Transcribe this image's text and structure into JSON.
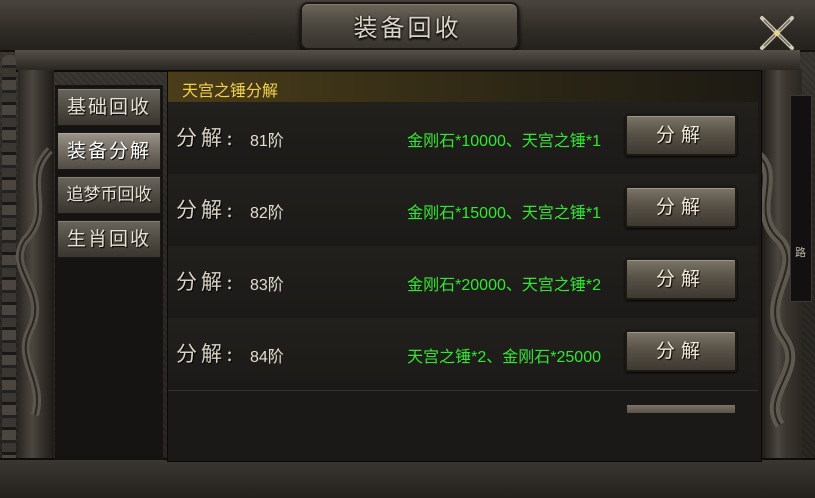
{
  "window": {
    "title": "装备回收"
  },
  "tabs": [
    {
      "label": "基础回收",
      "active": false
    },
    {
      "label": "装备分解",
      "active": true
    },
    {
      "label": "追梦币回收",
      "active": false
    },
    {
      "label": "生肖回收",
      "active": false
    }
  ],
  "panel": {
    "header": "天宫之锤分解",
    "rows": [
      {
        "label": "分解:",
        "tier": "81阶",
        "cost": "金刚石*10000、天宫之锤*1",
        "button": "分解"
      },
      {
        "label": "分解:",
        "tier": "82阶",
        "cost": "金刚石*15000、天宫之锤*1",
        "button": "分解"
      },
      {
        "label": "分解:",
        "tier": "83阶",
        "cost": "金刚石*20000、天宫之锤*2",
        "button": "分解"
      },
      {
        "label": "分解:",
        "tier": "84阶",
        "cost": "天宫之锤*2、金刚石*25000",
        "button": "分解"
      }
    ]
  },
  "side_edge_text": "路",
  "colors": {
    "header_text": "#f2d24a",
    "cost_text": "#33e633"
  }
}
